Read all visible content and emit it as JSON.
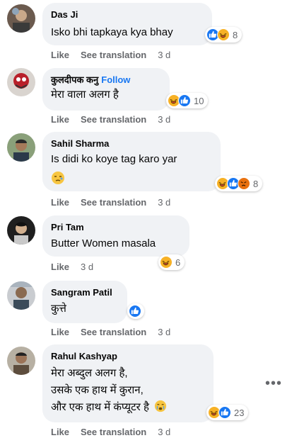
{
  "actions": {
    "like": "Like",
    "see_translation": "See translation"
  },
  "comments": [
    {
      "name": "Das Ji",
      "text": "Isko bhi tapkaya kya bhay",
      "reactions": 8,
      "time": "3 d"
    },
    {
      "name": "कुलदीपक कनु",
      "follow": "Follow",
      "text": "मेरा वाला अलग है",
      "reactions": 10,
      "time": "3 d"
    },
    {
      "name": "Sahil Sharma",
      "text": "Is didi ko koye tag karo yar",
      "reactions": 8,
      "time": "3 d"
    },
    {
      "name": "Pri Tam",
      "text": "Butter Women masala",
      "reactions": 6,
      "time": "3 d"
    },
    {
      "name": "Sangram Patil",
      "text": "कुत्ते",
      "time": "3 d"
    },
    {
      "name": "Rahul Kashyap",
      "lines": [
        "मेरा अब्दुल अलग है,",
        "उसके एक हाथ में कुरान,",
        "और एक हाथ में कंप्यूटर है"
      ],
      "reactions": 23,
      "time": "3 d"
    }
  ],
  "more_label": "•••",
  "colors": {
    "link": "#1877f2",
    "muted": "#65676b",
    "bubble": "#f0f2f5"
  }
}
